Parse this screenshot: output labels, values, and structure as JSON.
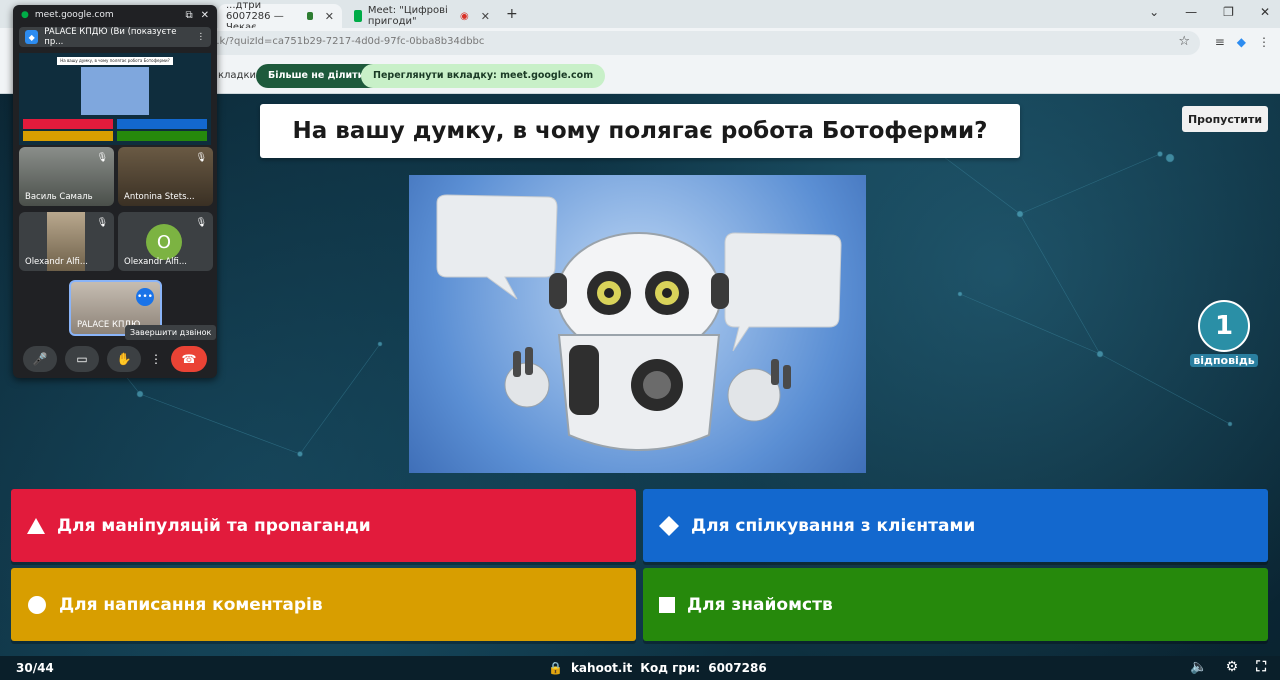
{
  "browser": {
    "tabs": [
      {
        "label": "...дтри 6007286 — Чекає",
        "active": true
      },
      {
        "label": "Meet: \"Цифрові пригоди\"",
        "active": false
      }
    ],
    "url": "...k/?quizId=ca751b29-7217-4d0d-97fc-0bba8b34dbbc",
    "share_text": "кладки",
    "stop_share": "Більше не ділитися",
    "view_tab": "Переглянути вкладку: meet.google.com"
  },
  "meet": {
    "origin": "meet.google.com",
    "presenter": "PALACE КПДЮ (Ви (показуєте пр...",
    "mini_question": "На вашу думку, в чому полягає робота Ботоферми?",
    "participants": [
      {
        "name": "Василь Самаль"
      },
      {
        "name": "Antonina Stets..."
      },
      {
        "name": "Olexandr Alfi..."
      },
      {
        "name": "Olexandr Alfi...",
        "initial": "O"
      },
      {
        "name": "PALACE КПДЮ"
      }
    ],
    "end_call_tooltip": "Завершити дзвінок"
  },
  "kahoot": {
    "question": "На вашу думку, в чому полягає робота Ботоферми?",
    "skip": "Пропустити",
    "answers_count": "1",
    "answers_label": "відповідь",
    "answers": [
      {
        "shape": "triangle",
        "text": "Для маніпуляцій та пропаганди",
        "color": "#e21b3c"
      },
      {
        "shape": "diamond",
        "text": "Для спілкування з клієнтами",
        "color": "#1368ce"
      },
      {
        "shape": "circle",
        "text": "Для написання коментарів",
        "color": "#d89e00"
      },
      {
        "shape": "square",
        "text": "Для знайомств",
        "color": "#26890c"
      }
    ],
    "counter": "30/44",
    "site": "kahoot.it",
    "pin_label": "Код гри:",
    "pin": "6007286"
  }
}
